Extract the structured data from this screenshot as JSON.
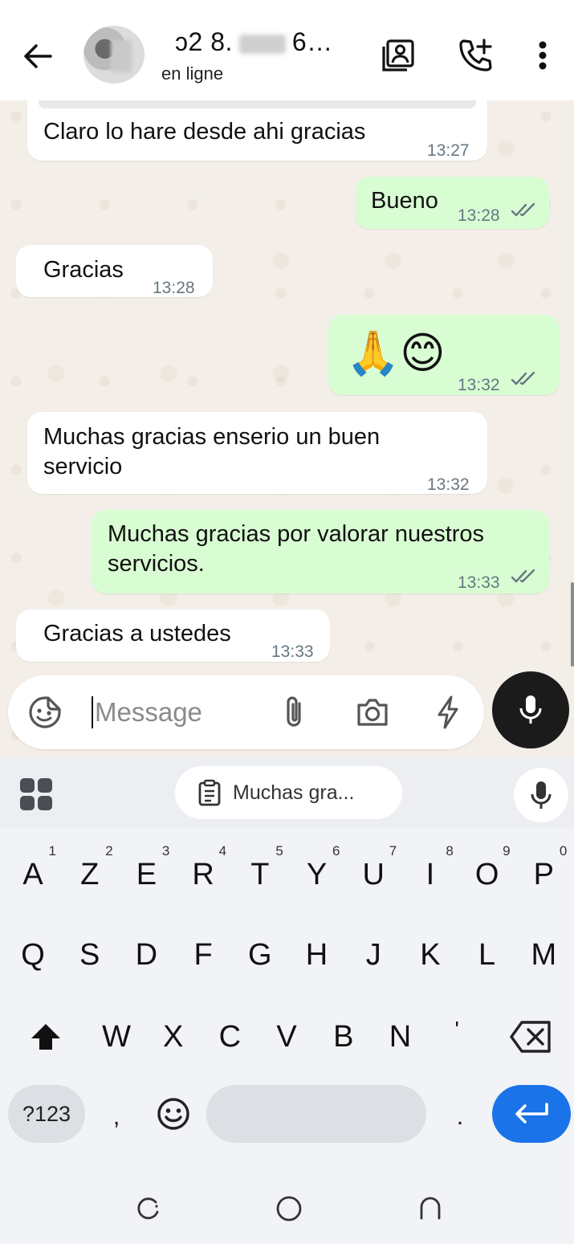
{
  "header": {
    "name_part1": "ɔ2 8.",
    "name_part2": "6…",
    "status": "en ligne"
  },
  "messages": [
    {
      "dir": "in",
      "text": "Claro lo hare desde ahi gracias",
      "time": "13:27"
    },
    {
      "dir": "out",
      "text": "Bueno",
      "time": "13:28",
      "ticks": "read"
    },
    {
      "dir": "in",
      "text": "Gracias",
      "time": "13:28"
    },
    {
      "dir": "out",
      "text": "🙏😊",
      "time": "13:32",
      "ticks": "read"
    },
    {
      "dir": "in",
      "text_line1": "Muchas gracias enserio un buen",
      "text_line2": "servicio",
      "time": "13:32"
    },
    {
      "dir": "out",
      "text_line1": "Muchas gracias por valorar nuestros",
      "text_line2": "servicios.",
      "time": "13:33",
      "ticks": "read"
    },
    {
      "dir": "in",
      "text": "Gracias a ustedes",
      "time": "13:33"
    }
  ],
  "composer": {
    "placeholder": "Message"
  },
  "keyboard": {
    "clipboard_suggestion": "Muchas gra...",
    "row1": [
      {
        "k": "A",
        "n": "1"
      },
      {
        "k": "Z",
        "n": "2"
      },
      {
        "k": "E",
        "n": "3"
      },
      {
        "k": "R",
        "n": "4"
      },
      {
        "k": "T",
        "n": "5"
      },
      {
        "k": "Y",
        "n": "6"
      },
      {
        "k": "U",
        "n": "7"
      },
      {
        "k": "I",
        "n": "8"
      },
      {
        "k": "O",
        "n": "9"
      },
      {
        "k": "P",
        "n": "0"
      }
    ],
    "row2": [
      "Q",
      "S",
      "D",
      "F",
      "G",
      "H",
      "J",
      "K",
      "L",
      "M"
    ],
    "row3": [
      "W",
      "X",
      "C",
      "V",
      "B",
      "N",
      "'"
    ],
    "numbers_key": "?123",
    "comma_key": ",",
    "period_key": "."
  },
  "colors": {
    "incoming_bubble": "#ffffff",
    "outgoing_bubble": "#d9fdd3",
    "enter_key": "#1a73e8",
    "mic_button": "#1b1b1b"
  }
}
